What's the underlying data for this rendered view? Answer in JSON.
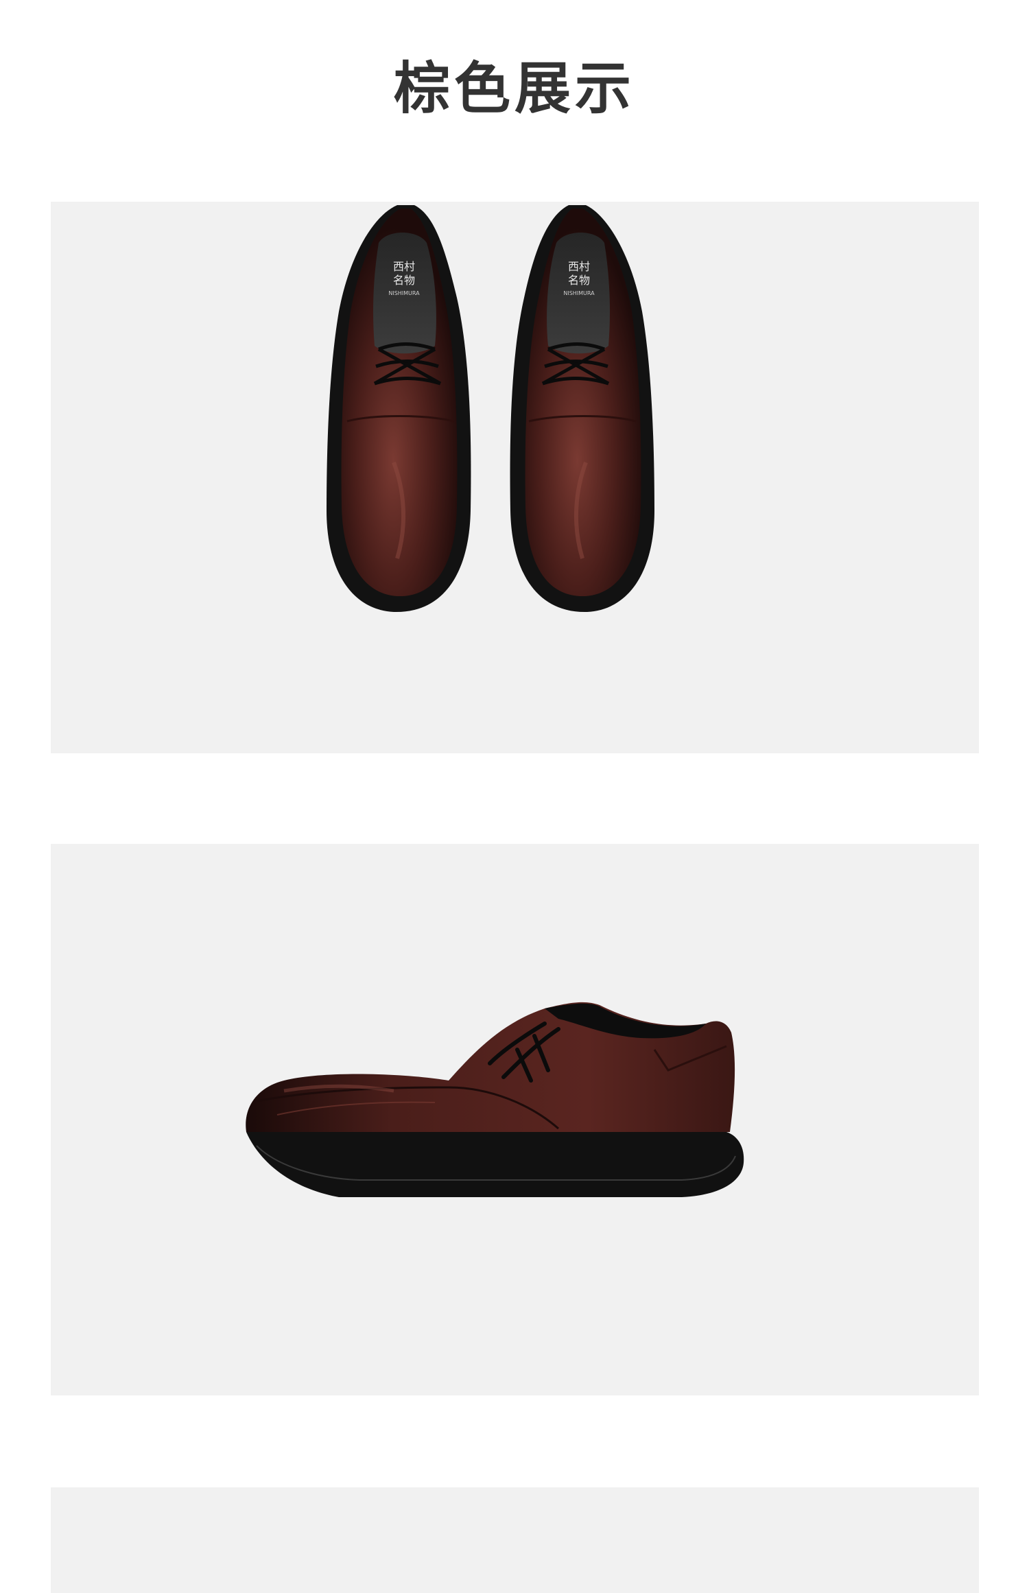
{
  "page": {
    "title": "棕色展示"
  },
  "products": [
    {
      "view": "top",
      "color": "#4a1e1a",
      "insole_mark_line1": "西村",
      "insole_mark_line2": "名物",
      "insole_mark_line3": "NISHIMURA"
    },
    {
      "view": "side",
      "color": "#4a1e1a"
    }
  ],
  "colors": {
    "panel_background": "#f1f1f1",
    "title_text": "#333333",
    "leather": "#4a1e1a",
    "sole": "#111111"
  }
}
